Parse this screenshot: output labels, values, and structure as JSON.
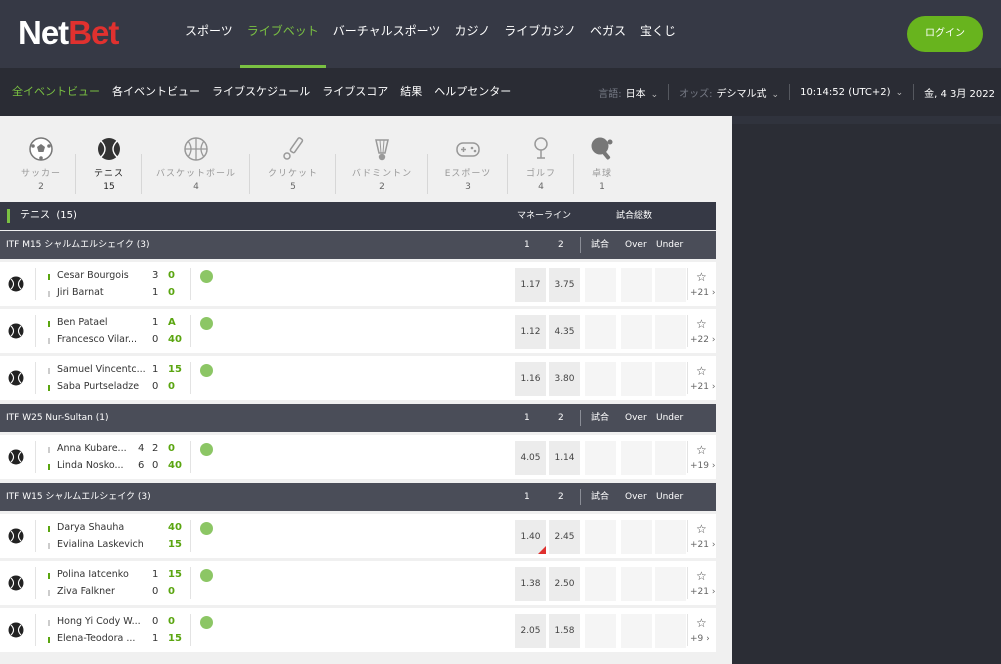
{
  "brand": {
    "part1": "Net",
    "part2": "Bet"
  },
  "main_nav": [
    "スポーツ",
    "ライブベット",
    "バーチャルスポーツ",
    "カジノ",
    "ライブカジノ",
    "ベガス",
    "宝くじ"
  ],
  "main_nav_active": 1,
  "login_label": "ログイン",
  "sub_nav": [
    "全イベントビュー",
    "各イベントビュー",
    "ライブスケジュール",
    "ライブスコア",
    "結果",
    "ヘルプセンター"
  ],
  "sub_nav_active": 0,
  "settings": {
    "lang_label": "言語:",
    "lang_value": "日本",
    "odds_label": "オッズ:",
    "odds_value": "デシマル式",
    "time_value": "10:14:52",
    "tz_value": "(UTC+2)",
    "date_value": "金, 4 3月 2022"
  },
  "sports": [
    {
      "name": "サッカー",
      "count": "2",
      "icon": "soccer-ball-icon"
    },
    {
      "name": "テニス",
      "count": "15",
      "icon": "tennis-ball-icon"
    },
    {
      "name": "バスケットボール",
      "count": "4",
      "icon": "basketball-icon"
    },
    {
      "name": "クリケット",
      "count": "5",
      "icon": "cricket-icon"
    },
    {
      "name": "バドミントン",
      "count": "2",
      "icon": "shuttlecock-icon"
    },
    {
      "name": "Eスポーツ",
      "count": "3",
      "icon": "gamepad-icon"
    },
    {
      "name": "ゴルフ",
      "count": "4",
      "icon": "golf-icon"
    },
    {
      "name": "卓球",
      "count": "1",
      "icon": "table-tennis-icon"
    }
  ],
  "section": {
    "title": "テニス",
    "count": "(15)",
    "col_moneyline": "マネーライン",
    "col_total_games": "試合総数"
  },
  "col_headers": {
    "c1": "1",
    "c2": "2",
    "games": "試合",
    "over": "Over",
    "under": "Under"
  },
  "leagues": [
    {
      "name": "ITF M15 シャルムエルシェイク (3)",
      "events": [
        {
          "p1": "Cesar Bourgois",
          "p2": "Jiri Barnat",
          "set1": [
            "3",
            "1"
          ],
          "pts": [
            "0",
            "0"
          ],
          "serve": 1,
          "odds1": "1.17",
          "odds2": "3.75",
          "more": "+21"
        },
        {
          "p1": "Ben Patael",
          "p2": "Francesco Vilar...",
          "set1": [
            "1",
            "0"
          ],
          "pts": [
            "A",
            "40"
          ],
          "serve": 1,
          "odds1": "1.12",
          "odds2": "4.35",
          "more": "+22"
        },
        {
          "p1": "Samuel Vincentc...",
          "p2": "Saba Purtseladze",
          "set1": [
            "1",
            "0"
          ],
          "pts": [
            "15",
            "0"
          ],
          "serve": 2,
          "odds1": "1.16",
          "odds2": "3.80",
          "more": "+21"
        }
      ]
    },
    {
      "name": "ITF W25 Nur-Sultan (1)",
      "events": [
        {
          "p1": "Anna Kubare...",
          "p2": "Linda Nosko...",
          "set1": [
            "4",
            "6"
          ],
          "set2": [
            "2",
            "0"
          ],
          "pts": [
            "0",
            "40"
          ],
          "serve": 2,
          "odds1": "4.05",
          "odds2": "1.14",
          "more": "+19"
        }
      ]
    },
    {
      "name": "ITF W15 シャルムエルシェイク (3)",
      "events": [
        {
          "p1": "Darya Shauha",
          "p2": "Evialina Laskevich",
          "set1": [],
          "pts": [
            "40",
            "15"
          ],
          "serve": 1,
          "odds1": "1.40",
          "odds2": "2.45",
          "more": "+21",
          "odds1_drop": true
        },
        {
          "p1": "Polina Iatcenko",
          "p2": "Ziva Falkner",
          "set1": [
            "1",
            "0"
          ],
          "pts": [
            "15",
            "0"
          ],
          "serve": 1,
          "odds1": "1.38",
          "odds2": "2.50",
          "more": "+21"
        },
        {
          "p1": "Hong Yi Cody W...",
          "p2": "Elena-Teodora ...",
          "set1": [
            "0",
            "1"
          ],
          "pts": [
            "0",
            "15"
          ],
          "serve": 2,
          "odds1": "2.05",
          "odds2": "1.58",
          "more": "+9"
        }
      ]
    }
  ],
  "colors": {
    "accent_green": "#7ac142",
    "brand_red": "#e0312f",
    "header_dark": "#363945"
  }
}
